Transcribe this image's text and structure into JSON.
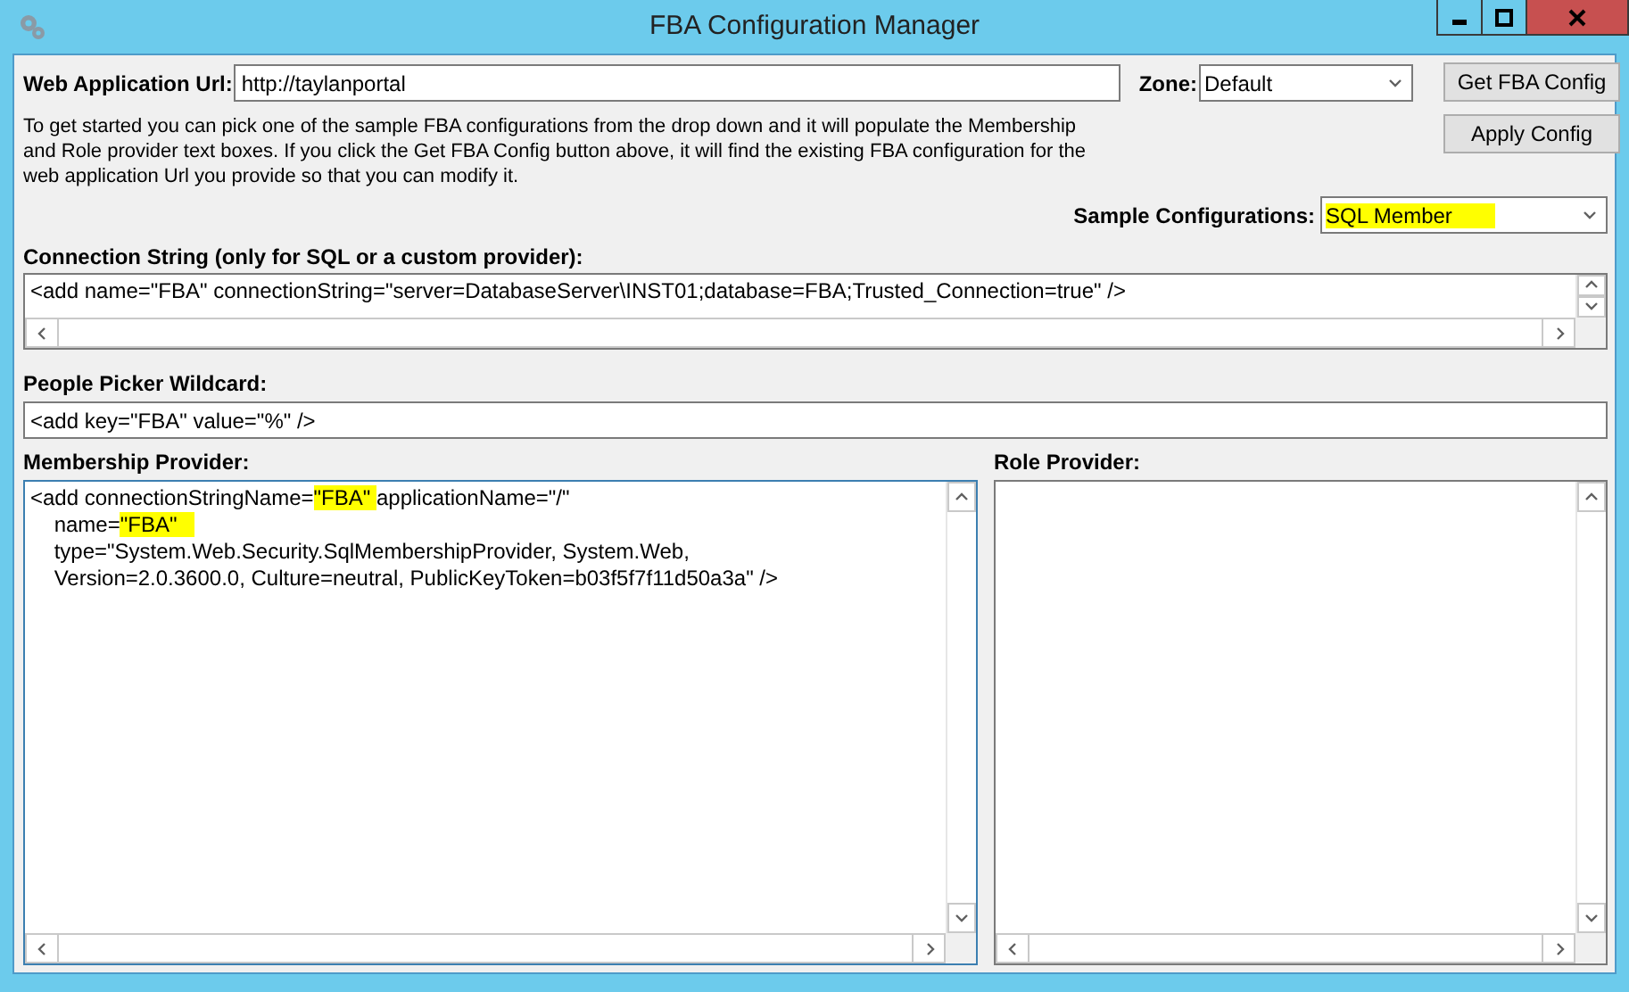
{
  "window": {
    "title": "FBA Configuration Manager"
  },
  "web_application_url": {
    "label": "Web Application Url:",
    "value": "http://taylanportal"
  },
  "zone": {
    "label": "Zone:",
    "value": "Default"
  },
  "buttons": [
    {
      "label": "Get FBA Config"
    },
    {
      "label": "Apply Config"
    }
  ],
  "description": "To get started you can pick one of the sample FBA configurations from the drop down and it will populate the Membership and Role provider text boxes.  If you click the Get FBA Config button above, it will find the existing FBA configuration for the web application Url you provide so that you can modify it.",
  "sample_configurations": {
    "label": "Sample Configurations:",
    "value": "SQL Member",
    "highlighted": true
  },
  "connection_string": {
    "label": "Connection String (only for SQL or a custom provider):",
    "lines": [
      [
        {
          "text": "<add name=\"FBA\" connectionString=\"server=DatabaseServer\\INST01;database=FBA;Trusted_Connection=true\" />",
          "highlighted": false
        }
      ]
    ]
  },
  "people_picker_wildcard": {
    "label": "People Picker Wildcard:",
    "value": "<add key=\"FBA\" value=\"%\" />"
  },
  "membership_provider": {
    "label": "Membership Provider:",
    "lines": [
      [
        {
          "text": "<add connectionStringName=",
          "highlighted": false
        },
        {
          "text": "\"FBA\" ",
          "highlighted": true
        },
        {
          "text": "applicationName=\"/\"",
          "highlighted": false
        }
      ],
      [
        {
          "text": "    name=",
          "highlighted": false
        },
        {
          "text": "\"FBA\"   ",
          "highlighted": true
        }
      ],
      [
        {
          "text": "    type=\"System.Web.Security.SqlMembershipProvider, System.Web,",
          "highlighted": false
        }
      ],
      [
        {
          "text": "    Version=2.0.3600.0, Culture=neutral, PublicKeyToken=b03f5f7f11d50a3a\" />",
          "highlighted": false
        }
      ]
    ]
  },
  "role_provider": {
    "label": "Role Provider:"
  }
}
